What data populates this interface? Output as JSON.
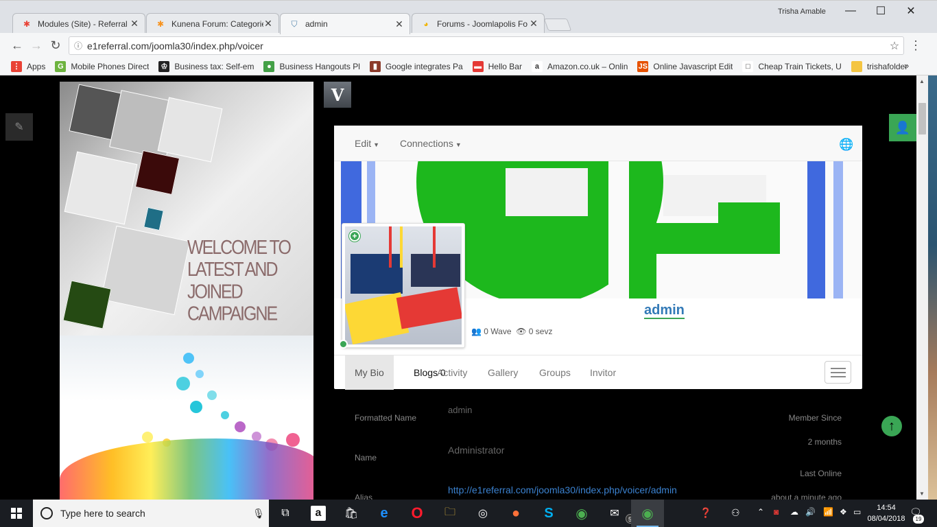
{
  "browser": {
    "tabs": [
      {
        "title": "Modules (Site) - Referral",
        "favicon": "joomla-icon"
      },
      {
        "title": "Kunena Forum: Categorie",
        "favicon": "joomla-icon"
      },
      {
        "title": "admin",
        "favicon": "shield-icon"
      },
      {
        "title": "Forums - Joomlapolis Fo",
        "favicon": "joomlapolis-icon"
      }
    ],
    "window_user": "Trisha Amable",
    "url": "e1referral.com/joomla30/index.php/voicer",
    "bookmarks": [
      {
        "label": "Apps",
        "color": "#e94235",
        "glyph": "⋮"
      },
      {
        "label": "Mobile Phones Direct",
        "color": "#6db33f",
        "glyph": "G"
      },
      {
        "label": "Business tax: Self-em",
        "color": "#222222",
        "glyph": "♔"
      },
      {
        "label": "Business Hangouts Pl",
        "color": "#43a047",
        "glyph": "●"
      },
      {
        "label": "Google integrates Pa",
        "color": "#8b3a2a",
        "glyph": "▮"
      },
      {
        "label": "Hello Bar",
        "color": "#e53935",
        "glyph": "▬"
      },
      {
        "label": "Amazon.co.uk – Onlin",
        "color": "#ffffff",
        "glyph": "a"
      },
      {
        "label": "Online Javascript Edit",
        "color": "#e65100",
        "glyph": "JS"
      },
      {
        "label": "Cheap Train Tickets, U",
        "color": "#ffffff",
        "glyph": "□"
      },
      {
        "label": "trishafolder",
        "color": "#f4c542",
        "glyph": ""
      }
    ],
    "bookmarks_more": "»"
  },
  "page": {
    "logo": "V",
    "banner_text": "WELCOME TO LATEST AND JOINED CAMPAIGNE",
    "profile_nav": {
      "edit": "Edit",
      "connections": "Connections"
    },
    "username": "admin",
    "stats": {
      "connections": "0 Wave",
      "views": "0 sevz"
    },
    "tabs": [
      {
        "label": "My Bio",
        "active": true
      },
      {
        "label": "Blogs 0",
        "active": false
      },
      {
        "label": "Activity",
        "active": false
      },
      {
        "label": "Gallery",
        "active": false
      },
      {
        "label": "Groups",
        "active": false
      },
      {
        "label": "Invitor",
        "active": false
      }
    ],
    "fields": [
      {
        "label": "Formatted Name",
        "value": "admin"
      },
      {
        "label": "Name",
        "value": "Administrator"
      },
      {
        "label": "Alias",
        "value": "http://e1referral.com/joomla30/index.php/voicer/admin"
      }
    ],
    "side": {
      "member_since_label": "Member Since",
      "member_since_value": "2 months",
      "last_online_label": "Last Online",
      "last_online_value": "about a minute ago"
    }
  },
  "taskbar": {
    "search_placeholder": "Type here to search",
    "mail_badge": "56",
    "time": "14:54",
    "date": "08/04/2018",
    "notifications": "19"
  }
}
